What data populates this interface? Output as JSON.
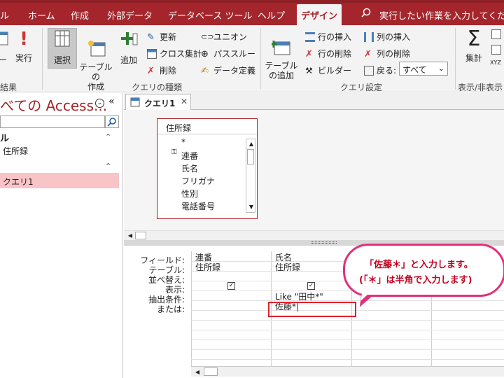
{
  "ribbon_tabs": {
    "t0": "ル",
    "t1": "ホーム",
    "t2": "作成",
    "t3": "外部データ",
    "t4": "データベース ツール",
    "t5": "ヘルプ",
    "t6": "デザイン",
    "tell_me": "実行したい作業を入力してください"
  },
  "ribbon": {
    "view_label": "ー",
    "run_label": "実行",
    "select_label": "選択",
    "table_create_label": "テーブルの\n作成",
    "add_label": "追加",
    "update_label": "更新",
    "crosstab_label": "クロス集計",
    "delete_label": "削除",
    "union_label": "ユニオン",
    "passthrough_label": "パススルー",
    "data_def_label": "データ定義",
    "show_table_label": "テーブル\nの追加",
    "insert_rows_label": "行の挿入",
    "delete_rows_label": "行の削除",
    "builder_label": "ビルダー",
    "insert_cols_label": "列の挿入",
    "delete_cols_label": "列の削除",
    "return_label": "戻る:",
    "return_value": "すべて",
    "totals_label": "集計",
    "groups": {
      "results": "結果",
      "query_type": "クエリの種類",
      "query_setup": "クエリ設定",
      "show_hide": "表示/非表示"
    }
  },
  "nav": {
    "title": "べての Access...",
    "group1": "ル",
    "group1_item": "住所録",
    "query_item": "クエリ1"
  },
  "document": {
    "tab_label": "クエリ1",
    "table": {
      "name": "住所録",
      "fields": [
        "*",
        "連番",
        "氏名",
        "フリガナ",
        "性別",
        "電話番号"
      ]
    },
    "grid_labels": [
      "フィールド:",
      "テーブル:",
      "並べ替え:",
      "表示:",
      "抽出条件:",
      "または:"
    ],
    "columns": [
      {
        "field": "連番",
        "table": "住所録",
        "show": "✓",
        "criteria": "",
        "or": ""
      },
      {
        "field": "氏名",
        "table": "住所録",
        "show": "✓",
        "criteria": "Like \"田中*\"",
        "or": "佐藤*|"
      }
    ]
  },
  "callout": {
    "line1": "「佐藤＊」と入力します。",
    "line2": "(「＊」は半角で入力します)"
  },
  "colors": {
    "accent": "#a4262c",
    "highlight": "#e2202a",
    "callout_border": "#e2307a",
    "callout_text": "#c4001e"
  }
}
